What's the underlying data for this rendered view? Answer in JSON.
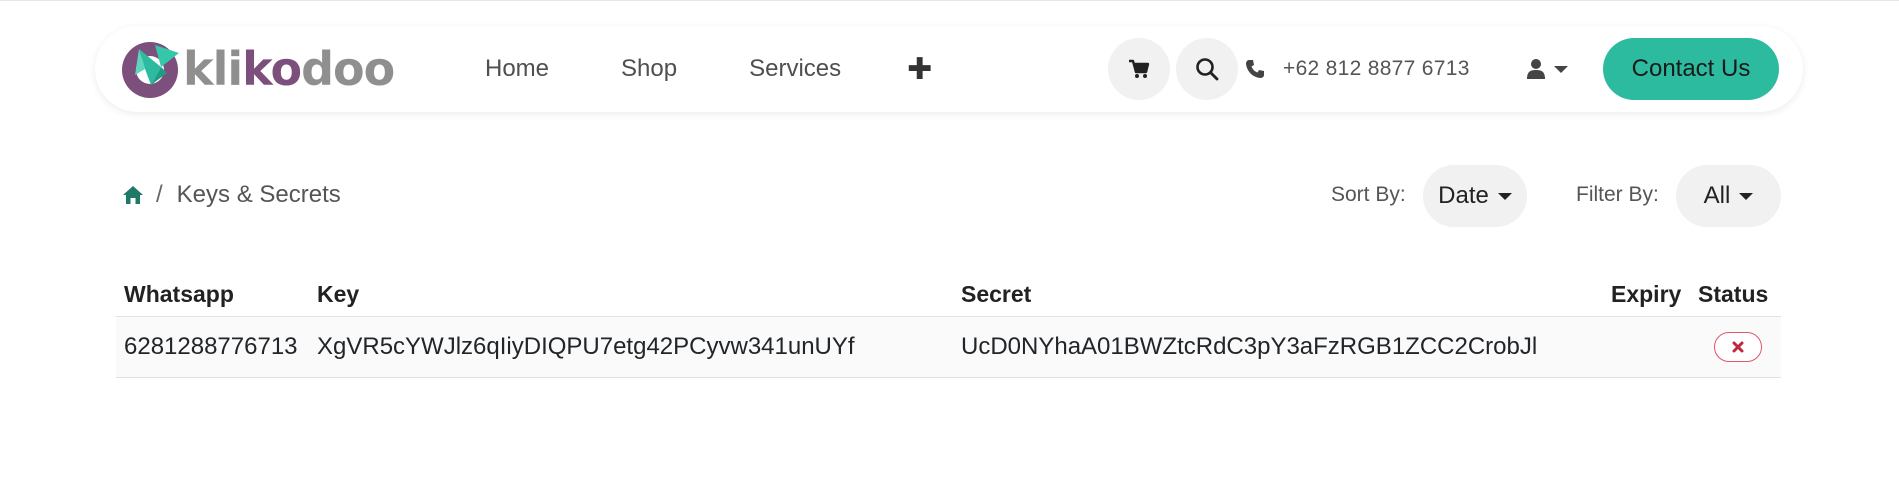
{
  "brand": {
    "logo_parts": [
      "kli",
      "ko",
      "doo"
    ],
    "colors": {
      "grey": "#8f8f8f",
      "purple": "#7c4f7d",
      "teal": "#2dbba0"
    }
  },
  "nav": {
    "links": [
      "Home",
      "Shop",
      "Services"
    ],
    "more_icon": "plus-icon",
    "cart_icon": "cart-icon",
    "search_icon": "search-icon",
    "phone_icon": "phone-icon",
    "phone": "+62 812 8877 6713",
    "user_icon": "user-icon",
    "contact_label": "Contact Us"
  },
  "breadcrumb": {
    "home_icon": "home-icon",
    "separator": "/",
    "current": "Keys & Secrets"
  },
  "controls": {
    "sort_label": "Sort By:",
    "sort_value": "Date",
    "filter_label": "Filter By:",
    "filter_value": "All"
  },
  "table": {
    "headers": {
      "whatsapp": "Whatsapp",
      "key": "Key",
      "secret": "Secret",
      "expiry": "Expiry",
      "status": "Status"
    },
    "rows": [
      {
        "whatsapp": "6281288776713",
        "key": "XgVR5cYWJlz6qIiyDIQPU7etg42PCyvw341unUYf",
        "secret": "UcD0NYhaA01BWZtcRdC3pY3aFzRGB1ZCC2CrobJl",
        "expiry": "",
        "status_icon": "close-icon",
        "status_color": "#c0283d"
      }
    ]
  }
}
